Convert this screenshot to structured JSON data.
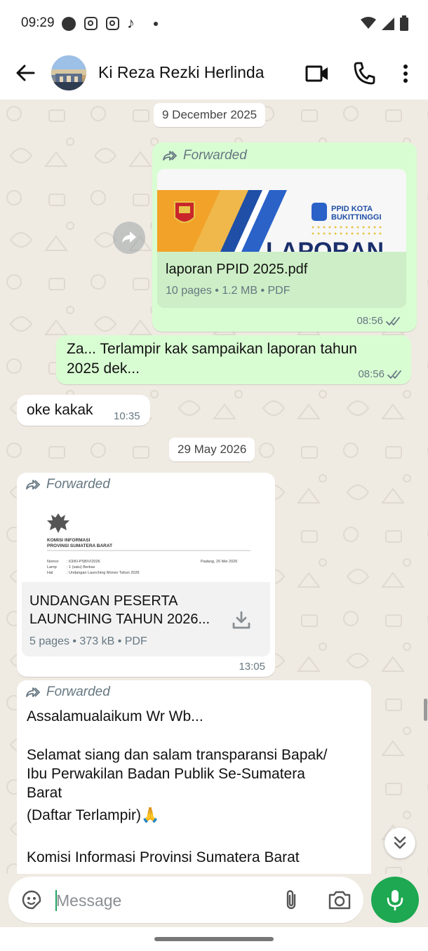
{
  "status_bar": {
    "time": "09:29",
    "icons": [
      "status-dot-icon",
      "instagram-icon",
      "instagram-icon",
      "tiktok-icon",
      "dot-icon",
      "wifi-icon",
      "signal-icon",
      "battery-icon"
    ]
  },
  "header": {
    "contact_name": "Ki Reza Rezki Herlinda",
    "icons": [
      "back-arrow-icon",
      "video-call-icon",
      "voice-call-icon",
      "more-vert-icon"
    ]
  },
  "dates": [
    "9 December 2025",
    "29 May 2026"
  ],
  "messages": [
    {
      "direction": "outgoing",
      "forwarded_label": "Forwarded",
      "document": {
        "preview_org": "PPID KOTA BUKITTINGGI",
        "preview_heading": "LAPORAN",
        "name": "laporan PPID 2025.pdf",
        "meta": "10 pages • 1.2 MB • PDF"
      },
      "time": "08:56",
      "status": "read"
    },
    {
      "direction": "outgoing",
      "text_line1": "Za... Terlampir kak sampaikan laporan tahun",
      "text_line2": "2025 dek...",
      "time": "08:56",
      "status": "read"
    },
    {
      "direction": "incoming",
      "text": "oke kakak",
      "time": "10:35"
    },
    {
      "direction": "incoming",
      "forwarded_label": "Forwarded",
      "document": {
        "preview_org_line1": "KOMISI INFORMASI",
        "preview_org_line2": "PROVINSI SUMATERA BARAT",
        "preview_nomor_label": "Nomor",
        "preview_nomor": ": 63/KI-PSB/V/2026",
        "preview_lamp_label": "Lamp",
        "preview_lamp": ": 1 (satu) Berkas",
        "preview_hal_label": "Hal",
        "preview_hal": ": Undangan Launching Monev Tahun 2026",
        "preview_date": "Padang, 26 Mei 2026",
        "name_line1": "UNDANGAN PESERTA",
        "name_line2": "LAUNCHING TAHUN 2026...",
        "meta": "5 pages • 373 kB • PDF"
      },
      "time": "13:05"
    },
    {
      "direction": "incoming",
      "forwarded_label": "Forwarded",
      "line1": "Assalamualaikum Wr Wb...",
      "line2": "Selamat siang dan salam transparansi Bapak/",
      "line3": "Ibu Perwakilan Badan Publik Se-Sumatera",
      "line4": "Barat",
      "line5": "(Daftar Terlampir)🙏",
      "line6": "Komisi Informasi Provinsi Sumatera Barat"
    }
  ],
  "composer": {
    "placeholder": "Message",
    "icons": [
      "sticker-icon",
      "attach-icon",
      "camera-icon",
      "mic-icon"
    ]
  }
}
